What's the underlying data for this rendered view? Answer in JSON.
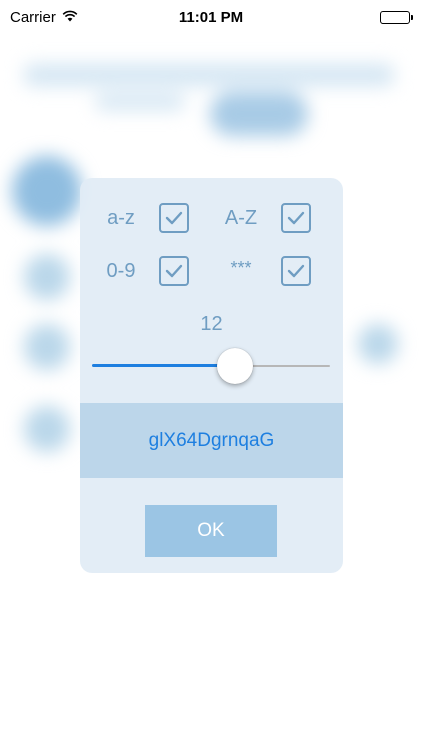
{
  "status_bar": {
    "carrier": "Carrier",
    "time": "11:01 PM"
  },
  "dialog": {
    "options": [
      {
        "label": "a-z",
        "checked": true
      },
      {
        "label": "A-Z",
        "checked": true
      },
      {
        "label": "0-9",
        "checked": true
      },
      {
        "label": "***",
        "checked": true
      }
    ],
    "length": {
      "value": "12",
      "slider_fraction": 0.6
    },
    "password": "glX64DgrnqaG",
    "ok_label": "OK"
  },
  "colors": {
    "accent": "#1e7fe0",
    "muted_blue": "#6f9dc2",
    "password_band": "#bcd6ea",
    "ok_button": "#9bc5e4"
  },
  "icons": {
    "wifi": "wifi-icon",
    "battery": "battery-icon",
    "checkbox": "check-icon"
  }
}
